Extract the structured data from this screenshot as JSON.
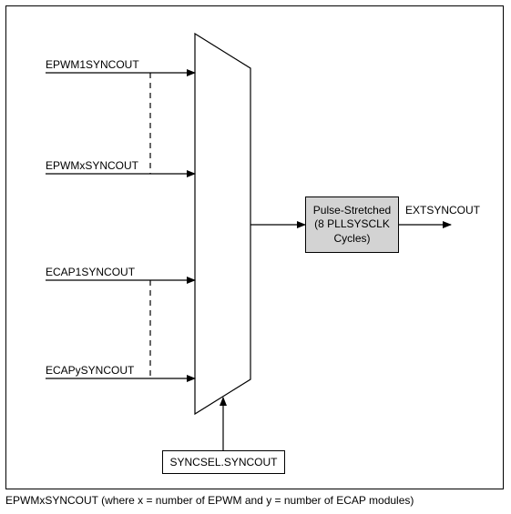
{
  "inputs": {
    "in1": "EPWM1SYNCOUT",
    "in2": "EPWMxSYNCOUT",
    "in3": "ECAP1SYNCOUT",
    "in4": "ECAPySYNCOUT"
  },
  "block": {
    "line1": "Pulse-Stretched",
    "line2": "(8 PLLSYSCLK",
    "line3": "Cycles)"
  },
  "output": "EXTSYNCOUT",
  "select": "SYNCSEL.SYNCOUT",
  "footnote": "EPWMxSYNCOUT (where x = number of EPWM and y = number of ECAP modules)"
}
